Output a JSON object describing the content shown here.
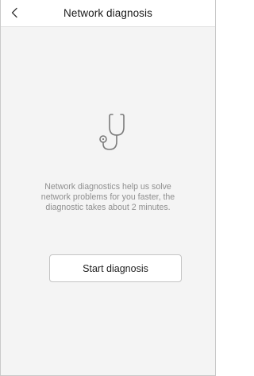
{
  "header": {
    "title": "Network diagnosis",
    "back_icon": "chevron-left-icon"
  },
  "main": {
    "hero_icon": "stethoscope-icon",
    "description": "Network diagnostics help us solve network problems for you faster, the diagnostic takes about 2 minutes.",
    "start_button_label": "Start diagnosis"
  },
  "colors": {
    "background": "#f4f4f4",
    "header_background": "#ffffff",
    "icon_stroke": "#7b7b7b",
    "description_text": "#8f8f8f",
    "button_border": "#c4c4c4"
  }
}
